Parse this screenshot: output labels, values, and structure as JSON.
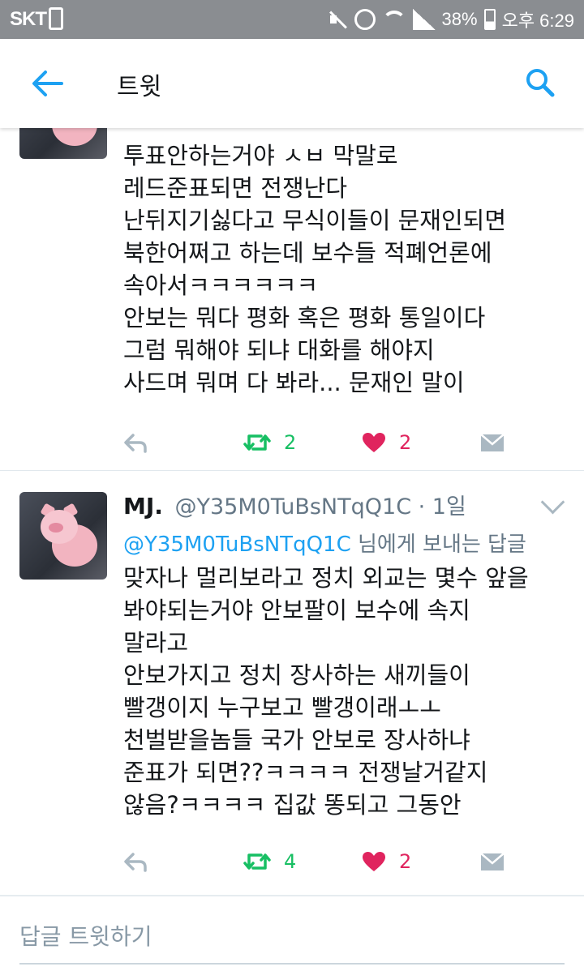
{
  "status_bar": {
    "carrier": "SKT",
    "battery": "38%",
    "time": "오후 6:29"
  },
  "app_bar": {
    "title": "트윗"
  },
  "tweets": [
    {
      "cut_off": true,
      "lines": [
        "투표안하는거야 ㅅㅂ 막말로",
        "레드준표되면 전쟁난다",
        "난뒤지기싫다고 무식이들이 문재인되면",
        "북한어쩌고 하는데 보수들 적폐언론에",
        "속아서ㅋㅋㅋㅋㅋㅋ",
        "안보는 뭐다 평화 혹은 평화 통일이다",
        "그럼 뭐해야 되냐 대화를 해야지",
        "사드며 뭐며 다 봐라... 문재인 말이"
      ],
      "retweets": "2",
      "likes": "2"
    },
    {
      "name": "MJ.",
      "handle": "@Y35M0TuBsNTqQ1C",
      "time": "· 1일",
      "reply_mention": "@Y35M0TuBsNTqQ1C",
      "reply_suffix": " 님에게 보내는 답글",
      "lines": [
        "맞자나 멀리보라고 정치 외교는 몇수 앞을",
        "봐야되는거야 안보팔이 보수에 속지",
        "말라고",
        "안보가지고 정치 장사하는 새끼들이",
        "빨갱이지 누구보고 빨갱이래ㅗㅗ",
        "천벌받을놈들 국가 안보로 장사하냐",
        "준표가 되면??ㅋㅋㅋㅋ 전쟁날거같지",
        "않음?ㅋㅋㅋㅋ 집값 똥되고 그동안"
      ],
      "retweets": "4",
      "likes": "2"
    }
  ],
  "reply_box": {
    "placeholder": "답글 트윗하기"
  },
  "colors": {
    "accent": "#1da1f2",
    "retweet": "#17bf63",
    "like": "#e0245e",
    "status_bar": "#8a8d91"
  },
  "icons": [
    "back-arrow-icon",
    "search-icon",
    "reply-icon",
    "retweet-icon",
    "heart-icon",
    "dm-icon",
    "chevron-down-icon"
  ]
}
